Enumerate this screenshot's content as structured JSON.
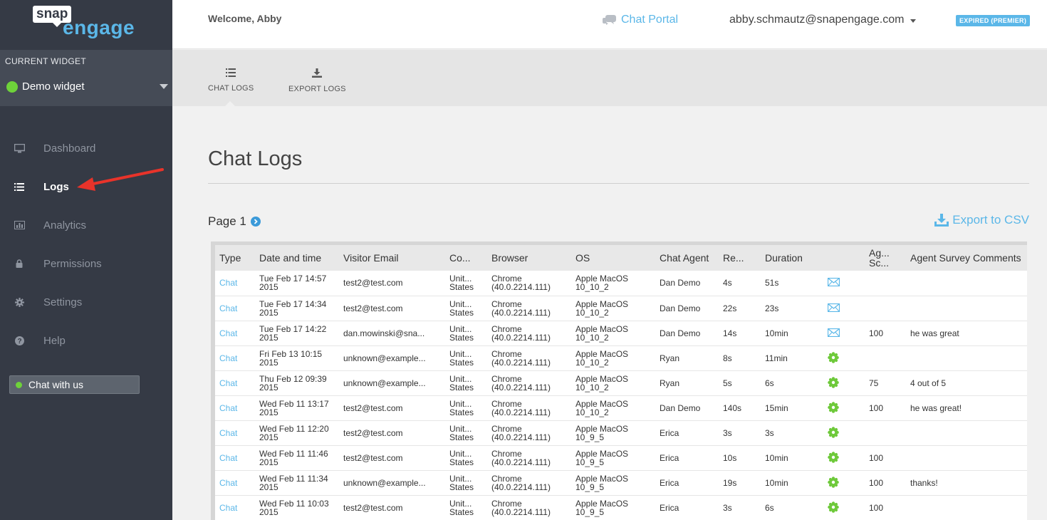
{
  "logo": {
    "snap": "snap",
    "engage": "engage"
  },
  "widget": {
    "caption": "CURRENT WIDGET",
    "name": "Demo widget"
  },
  "nav": [
    {
      "label": "Dashboard",
      "icon": "monitor-icon",
      "active": false
    },
    {
      "label": "Logs",
      "icon": "list-icon",
      "active": true
    },
    {
      "label": "Analytics",
      "icon": "bar-chart-icon",
      "active": false
    },
    {
      "label": "Permissions",
      "icon": "lock-icon",
      "active": false
    },
    {
      "label": "Settings",
      "icon": "gear-icon",
      "active": false
    },
    {
      "label": "Help",
      "icon": "question-icon",
      "active": false
    }
  ],
  "chat_with_us": "Chat with us",
  "header": {
    "welcome": "Welcome, Abby",
    "chat_portal": "Chat Portal",
    "email": "abby.schmautz@snapengage.com",
    "badge": "EXPIRED (PREMIER)"
  },
  "tabs": [
    {
      "label": "CHAT LOGS",
      "icon": "list-icon"
    },
    {
      "label": "EXPORT LOGS",
      "icon": "download-icon"
    }
  ],
  "page": {
    "title": "Chat Logs",
    "page_indicator": "Page 1",
    "export_csv": "Export to CSV"
  },
  "table": {
    "columns": [
      "Type",
      "Date and time",
      "Visitor Email",
      "Co...",
      "Browser",
      "OS",
      "Chat Agent",
      "Re...",
      "Duration",
      "",
      "Ag... Sc...",
      "Agent Survey Comments"
    ],
    "rows": [
      {
        "type": "Chat",
        "date": "Tue Feb 17 14:57 2015",
        "email": "test2@test.com",
        "country": "Unit... States",
        "browser": "Chrome (40.0.2214.111)",
        "os": "Apple MacOS 10_10_2",
        "agent": "Dan Demo",
        "response": "4s",
        "duration": "51s",
        "icon": "envelope-icon",
        "score": "",
        "comment": ""
      },
      {
        "type": "Chat",
        "date": "Tue Feb 17 14:34 2015",
        "email": "test2@test.com",
        "country": "Unit... States",
        "browser": "Chrome (40.0.2214.111)",
        "os": "Apple MacOS 10_10_2",
        "agent": "Dan Demo",
        "response": "22s",
        "duration": "23s",
        "icon": "envelope-icon",
        "score": "",
        "comment": ""
      },
      {
        "type": "Chat",
        "date": "Tue Feb 17 14:22 2015",
        "email": "dan.mowinski@sna...",
        "country": "Unit... States",
        "browser": "Chrome (40.0.2214.111)",
        "os": "Apple MacOS 10_10_2",
        "agent": "Dan Demo",
        "response": "14s",
        "duration": "10min",
        "icon": "envelope-icon",
        "score": "100",
        "comment": "he was great"
      },
      {
        "type": "Chat",
        "date": "Fri Feb 13 10:15 2015",
        "email": "unknown@example...",
        "country": "Unit... States",
        "browser": "Chrome (40.0.2214.111)",
        "os": "Apple MacOS 10_10_2",
        "agent": "Ryan",
        "response": "8s",
        "duration": "11min",
        "icon": "green-badge-icon",
        "score": "",
        "comment": ""
      },
      {
        "type": "Chat",
        "date": "Thu Feb 12 09:39 2015",
        "email": "unknown@example...",
        "country": "Unit... States",
        "browser": "Chrome (40.0.2214.111)",
        "os": "Apple MacOS 10_10_2",
        "agent": "Ryan",
        "response": "5s",
        "duration": "6s",
        "icon": "green-badge-icon",
        "score": "75",
        "comment": "4 out of 5"
      },
      {
        "type": "Chat",
        "date": "Wed Feb 11 13:17 2015",
        "email": "test2@test.com",
        "country": "Unit... States",
        "browser": "Chrome (40.0.2214.111)",
        "os": "Apple MacOS 10_10_2",
        "agent": "Dan Demo",
        "response": "140s",
        "duration": "15min",
        "icon": "green-badge-icon",
        "score": "100",
        "comment": "he was great!"
      },
      {
        "type": "Chat",
        "date": "Wed Feb 11 12:20 2015",
        "email": "test2@test.com",
        "country": "Unit... States",
        "browser": "Chrome (40.0.2214.111)",
        "os": "Apple MacOS 10_9_5",
        "agent": "Erica",
        "response": "3s",
        "duration": "3s",
        "icon": "green-badge-icon",
        "score": "",
        "comment": ""
      },
      {
        "type": "Chat",
        "date": "Wed Feb 11 11:46 2015",
        "email": "test2@test.com",
        "country": "Unit... States",
        "browser": "Chrome (40.0.2214.111)",
        "os": "Apple MacOS 10_9_5",
        "agent": "Erica",
        "response": "10s",
        "duration": "10min",
        "icon": "green-badge-icon",
        "score": "100",
        "comment": ""
      },
      {
        "type": "Chat",
        "date": "Wed Feb 11 11:34 2015",
        "email": "unknown@example...",
        "country": "Unit... States",
        "browser": "Chrome (40.0.2214.111)",
        "os": "Apple MacOS 10_9_5",
        "agent": "Erica",
        "response": "19s",
        "duration": "10min",
        "icon": "green-badge-icon",
        "score": "100",
        "comment": "thanks!"
      },
      {
        "type": "Chat",
        "date": "Wed Feb 11 10:03 2015",
        "email": "test2@test.com",
        "country": "Unit... States",
        "browser": "Chrome (40.0.2214.111)",
        "os": "Apple MacOS 10_9_5",
        "agent": "Erica",
        "response": "3s",
        "duration": "6s",
        "icon": "green-badge-icon",
        "score": "100",
        "comment": ""
      }
    ]
  },
  "colors": {
    "sidebar_bg": "#353a45",
    "accent": "#5bb7e8",
    "status_green": "#6ed23a",
    "annotation_arrow": "#e8332a"
  }
}
